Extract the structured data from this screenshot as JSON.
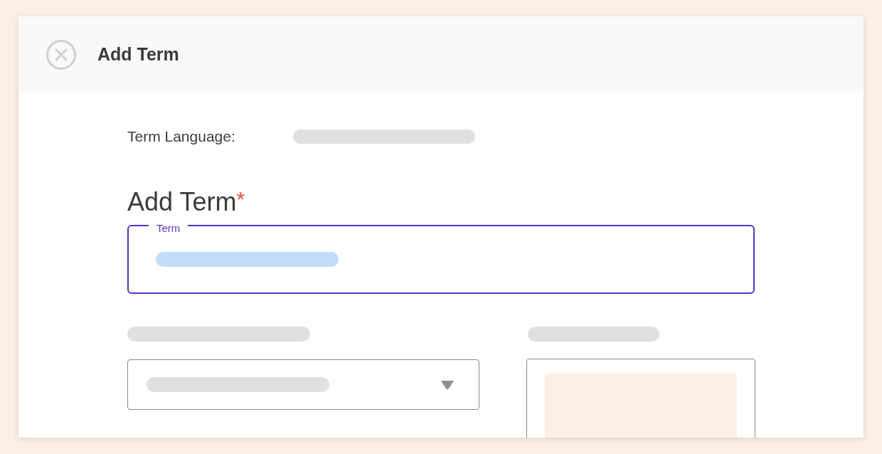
{
  "dialog": {
    "title": "Add Term"
  },
  "form": {
    "language_label": "Term Language:",
    "heading": "Add Term",
    "required_mark": "*",
    "term_field": {
      "label": "Term",
      "focused": true
    }
  }
}
